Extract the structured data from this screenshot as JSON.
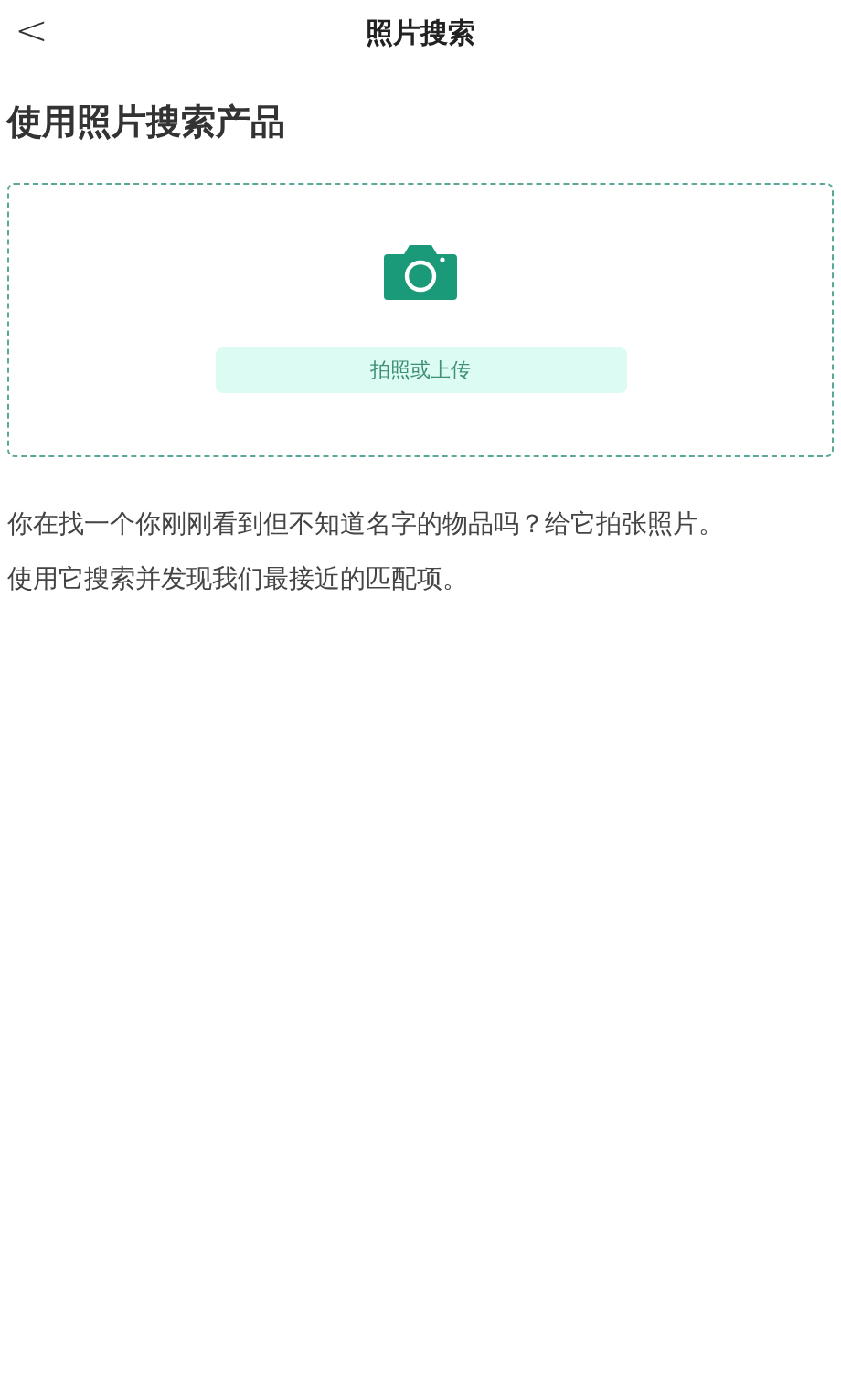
{
  "header": {
    "back": "<",
    "title": "照片搜索"
  },
  "heading": "使用照片搜索产品",
  "upload": {
    "button": "拍照或上传"
  },
  "paragraphs": [
    "你在找一个你刚刚看到但不知道名字的物品吗？给它拍张照片。",
    "使用它搜索并发现我们最接近的匹配项。"
  ]
}
